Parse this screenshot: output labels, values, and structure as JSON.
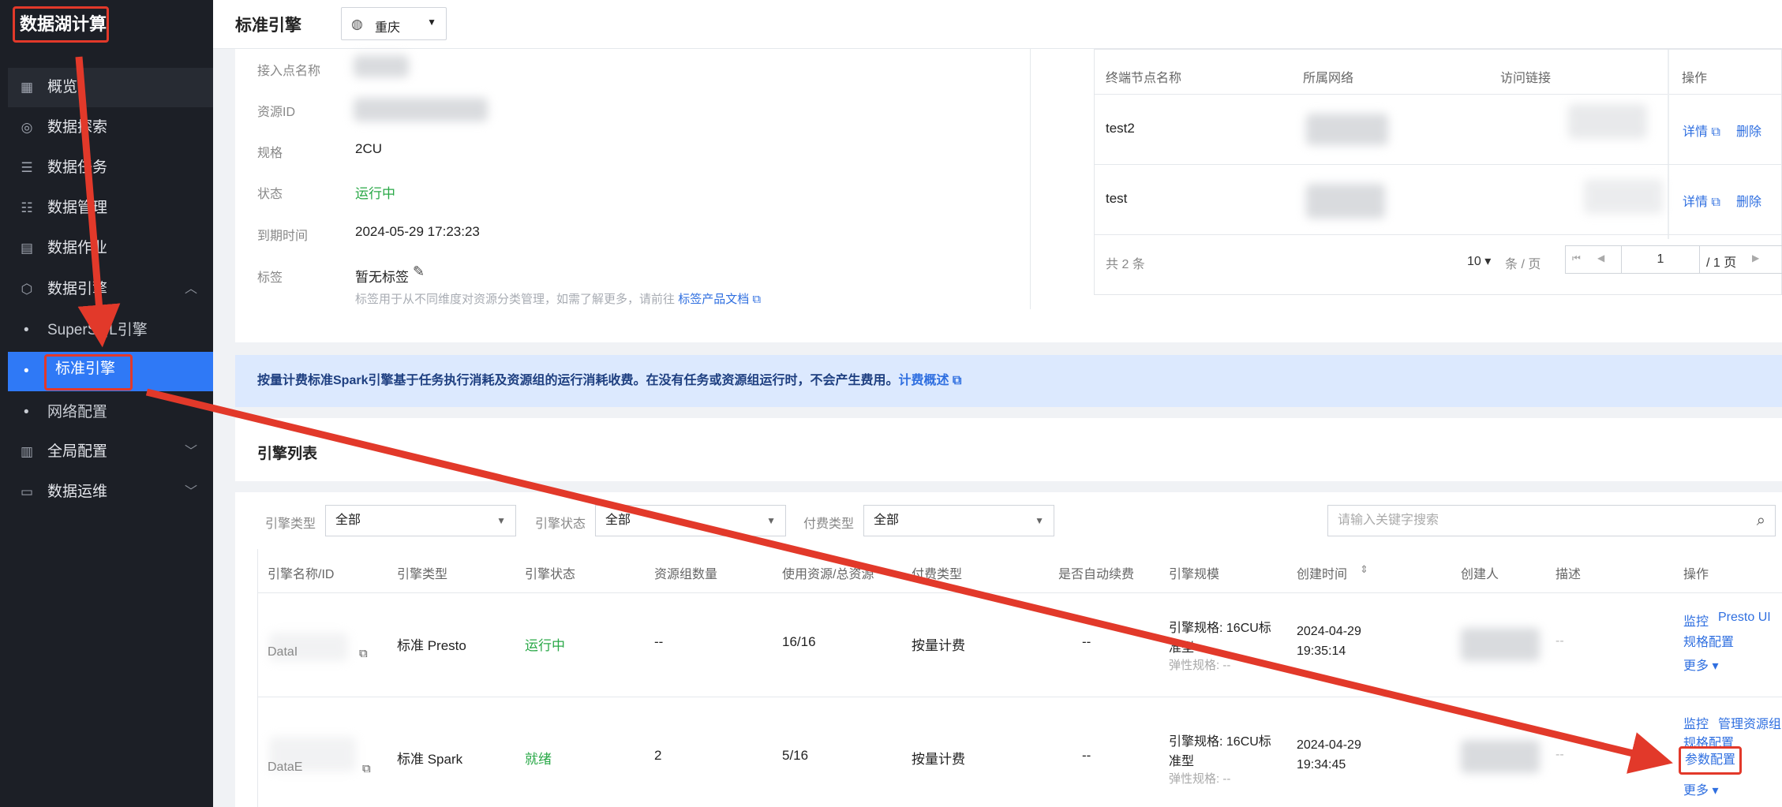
{
  "sidebar": {
    "app_title": "数据湖计算",
    "items": [
      {
        "label": "概览",
        "icon": "grid-icon"
      },
      {
        "label": "数据探索",
        "icon": "search-icon"
      },
      {
        "label": "数据任务",
        "icon": "list-icon"
      },
      {
        "label": "数据管理",
        "icon": "sliders-icon"
      },
      {
        "label": "数据作业",
        "icon": "document-icon"
      },
      {
        "label": "数据引擎",
        "icon": "cube-icon"
      },
      {
        "label": "全局配置",
        "icon": "dashboard-icon"
      },
      {
        "label": "数据运维",
        "icon": "monitor-icon"
      }
    ],
    "sub_items": [
      "SuperSQL引擎",
      "标准引擎",
      "网络配置"
    ]
  },
  "header": {
    "title": "标准引擎",
    "region": "重庆"
  },
  "detail": {
    "rows": [
      {
        "key": "接入点名称",
        "value": ""
      },
      {
        "key": "资源ID",
        "value": ""
      },
      {
        "key": "规格",
        "value": "2CU"
      },
      {
        "key": "状态",
        "value": "运行中"
      },
      {
        "key": "到期时间",
        "value": "2024-05-29 17:23:23"
      },
      {
        "key": "标签",
        "value": "暂无标签"
      }
    ],
    "tag_hint": "标签用于从不同维度对资源分类管理，如需了解更多，请前往",
    "tag_link": "标签产品文档"
  },
  "endpoints": {
    "columns": [
      "终端节点名称",
      "所属网络",
      "访问链接",
      "操作"
    ],
    "rows": [
      {
        "name": "test2",
        "detail": "详情",
        "delete": "删除"
      },
      {
        "name": "test",
        "detail": "详情",
        "delete": "删除"
      }
    ],
    "total": "共 2 条",
    "page_size": "10",
    "per_page": "条 / 页",
    "page": "1",
    "page_total": "/ 1 页"
  },
  "banner": {
    "text": "按量计费标准Spark引擎基于任务执行消耗及资源组的运行消耗收费。在没有任务或资源组运行时，不会产生费用。",
    "link": "计费概述"
  },
  "engine_list": {
    "title": "引擎列表",
    "filters": [
      {
        "label": "引擎类型",
        "value": "全部"
      },
      {
        "label": "引擎状态",
        "value": "全部"
      },
      {
        "label": "付费类型",
        "value": "全部"
      }
    ],
    "search_placeholder": "请输入关键字搜索",
    "columns": [
      "引擎名称/ID",
      "引擎类型",
      "引擎状态",
      "资源组数量",
      "使用资源/总资源",
      "付费类型",
      "是否自动续费",
      "引擎规模",
      "创建时间",
      "创建人",
      "描述",
      "操作"
    ],
    "rows": [
      {
        "name": "DataI",
        "type": "标准 Presto",
        "status": "运行中",
        "groups": "--",
        "usage": "16/16",
        "pay": "按量计费",
        "renew": "--",
        "spec1": "引擎规格: 16CU标",
        "spec2": "准型",
        "spec3": "弹性规格: --",
        "date": "2024-04-29",
        "time": "19:35:14",
        "desc": "--",
        "ops": [
          "监控",
          "Presto UI",
          "规格配置",
          "更多"
        ]
      },
      {
        "name": "DataE",
        "type": "标准 Spark",
        "status": "就绪",
        "groups": "2",
        "usage": "5/16",
        "pay": "按量计费",
        "renew": "--",
        "spec1": "引擎规格: 16CU标",
        "spec2": "准型",
        "spec3": "弹性规格: --",
        "date": "2024-04-29",
        "time": "19:34:45",
        "desc": "--",
        "ops": [
          "监控",
          "管理资源组",
          "规格配置",
          "参数配置",
          "更多"
        ]
      }
    ]
  },
  "colors": {
    "accent": "#2f79f6",
    "annotation": "#e2392a",
    "running": "#29a847"
  }
}
